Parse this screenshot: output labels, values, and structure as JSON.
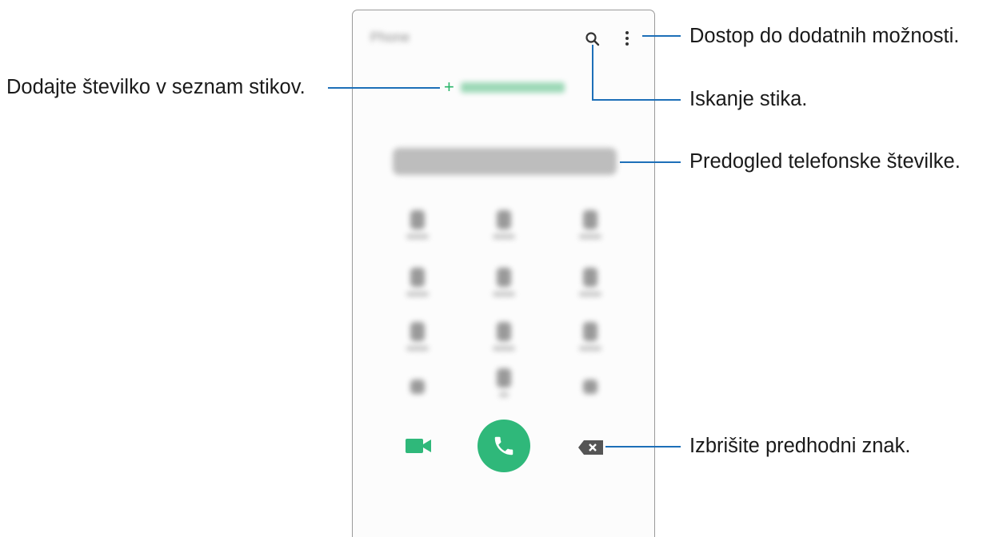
{
  "phone": {
    "app_title": "Phone",
    "keys": [
      "1",
      "2",
      "3",
      "4",
      "5",
      "6",
      "7",
      "8",
      "9",
      "*",
      "0",
      "#"
    ]
  },
  "callouts": {
    "more_options": "Dostop do dodatnih možnosti.",
    "add_to_contacts": "Dodajte številko v seznam stikov.",
    "search_contact": "Iskanje stika.",
    "number_preview": "Predogled telefonske številke.",
    "delete_char": "Izbrišite predhodni znak."
  },
  "colors": {
    "accent_green": "#2fb87a",
    "callout_blue": "#1d6fb8"
  }
}
